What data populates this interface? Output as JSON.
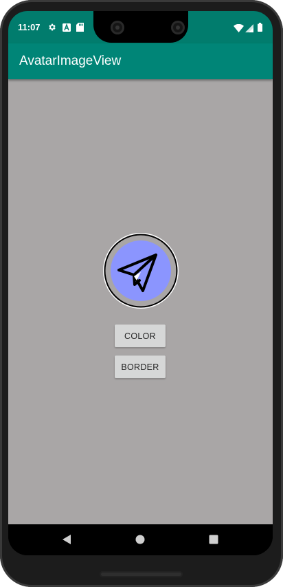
{
  "status_bar": {
    "time": "11:07",
    "icons": [
      "settings-icon",
      "a-badge-icon",
      "sd-card-icon",
      "wifi-icon",
      "signal-icon",
      "battery-icon"
    ]
  },
  "app_bar": {
    "title": "AvatarImageView"
  },
  "avatar": {
    "icon": "paper-plane-icon",
    "fill_color": "#8b95fe",
    "ring_color": "#a9a6a6",
    "border_color": "#000000"
  },
  "buttons": {
    "color_label": "COLOR",
    "border_label": "BORDER"
  },
  "nav_bar": {
    "items": [
      "back-icon",
      "home-icon",
      "recents-icon"
    ]
  },
  "colors": {
    "status_bar": "#017c6d",
    "app_bar": "#008577",
    "background": "#a9a6a6",
    "button": "#d6d7d7"
  }
}
